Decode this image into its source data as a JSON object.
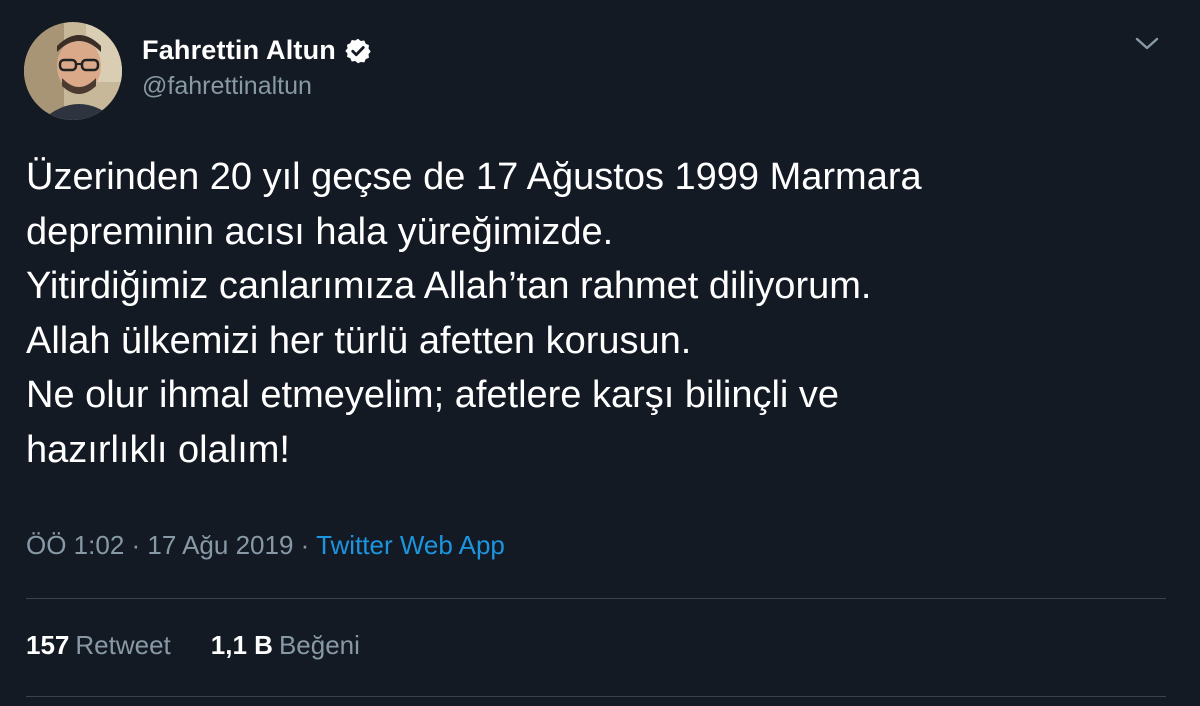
{
  "author": {
    "display_name": "Fahrettin Altun",
    "handle": "@fahrettinaltun",
    "verified": true
  },
  "tweet": {
    "text": "Üzerinden 20 yıl geçse de 17 Ağustos 1999 Marmara\ndepreminin acısı hala yüreğimizde.\nYitirdiğimiz canlarımıza Allah’tan rahmet diliyorum.\nAllah ülkemizi her türlü afetten korusun.\nNe olur ihmal etmeyelim; afetlere karşı bilinçli ve\nhazırlıklı olalım!",
    "timestamp": "ÖÖ 1:02 · 17 Ağu 2019 · ",
    "source": "Twitter Web App"
  },
  "stats": {
    "retweets_count": "157",
    "retweets_label": "Retweet",
    "likes_count": "1,1 B",
    "likes_label": "Beğeni"
  },
  "colors": {
    "background": "#141a24",
    "secondary_text": "#8899a6",
    "link": "#1b95e0"
  },
  "icons": {
    "verified": "verified-badge-icon",
    "more": "chevron-down-icon"
  }
}
